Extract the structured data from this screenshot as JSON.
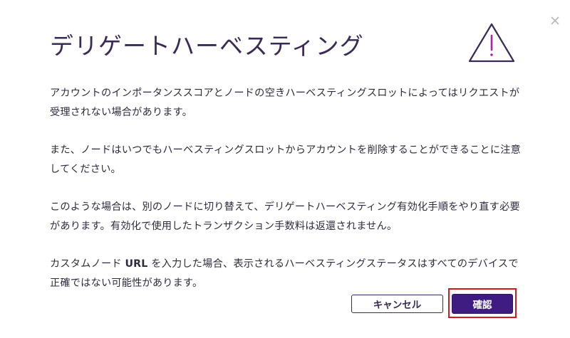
{
  "dialog": {
    "title": "デリゲートハーベスティング",
    "paragraphs": [
      "アカウントのインポータンススコアとノードの空きハーベスティングスロットによってはリクエストが受理されない場合があります。",
      "また、ノードはいつでもハーベスティングスロットからアカウントを削除することができることに注意してください。",
      "このような場合は、別のノードに切り替えて、デリゲートハーベスティング有効化手順をやり直す必要があります。有効化で使用したトランザクション手数料は返還されません。"
    ],
    "custom_url_para": {
      "before": "カスタムノード ",
      "url": "URL",
      "after": " を入力した場合、表示されるハーベスティングステータスはすべてのデバイスで正確ではない可能性があります。"
    },
    "buttons": {
      "cancel": "キャンセル",
      "confirm": "確認"
    },
    "icons": {
      "close": "close-icon",
      "warning": "warning-triangle-icon"
    },
    "colors": {
      "primary": "#3e1c82",
      "accent": "#b01fa6",
      "highlight": "#e0121b",
      "text": "#2f2a40"
    }
  }
}
